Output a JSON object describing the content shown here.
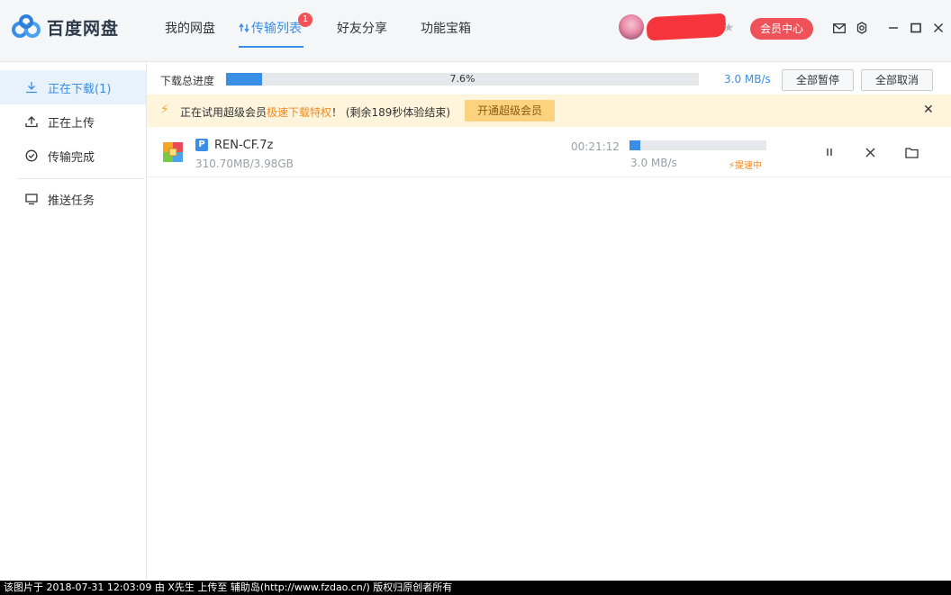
{
  "app": {
    "title": "百度网盘"
  },
  "nav": {
    "items": [
      {
        "label": "我的网盘"
      },
      {
        "label": "传输列表",
        "badge": "1"
      },
      {
        "label": "好友分享"
      },
      {
        "label": "功能宝箱"
      }
    ],
    "active_index": 1
  },
  "user": {
    "vip_button": "会员中心"
  },
  "icons": [
    "baidu-netdisk-logo-icon",
    "swap-arrows-icon",
    "star-icon",
    "mail-icon",
    "gear-icon",
    "minimize-icon",
    "maximize-icon",
    "close-icon",
    "download-icon",
    "upload-icon",
    "check-circle-icon",
    "monitor-icon",
    "lightning-icon",
    "archive-file-icon",
    "pause-icon",
    "cancel-icon",
    "folder-icon"
  ],
  "colors": {
    "accent": "#3a8ee6",
    "vip": "#f0525a",
    "promo_bg": "#fff5dd",
    "promo_highlight": "#f08a24"
  },
  "sidebar": {
    "items": [
      {
        "label": "正在下载(1)",
        "active": true
      },
      {
        "label": "正在上传"
      },
      {
        "label": "传输完成"
      },
      {
        "label": "推送任务"
      }
    ]
  },
  "transfer": {
    "total_label": "下载总进度",
    "total_progress": 0.076,
    "total_progress_text": "7.6%",
    "total_speed": "3.0 MB/s",
    "pause_all": "全部暂停",
    "cancel_all": "全部取消"
  },
  "promo": {
    "text_prefix": "正在试用超级会员",
    "text_highlight": "极速下载特权",
    "text_suffix": "！ (剩余189秒体验结束)",
    "button": "开通超级会员"
  },
  "files": [
    {
      "tag": "P",
      "name": "REN-CF.7z",
      "size": "310.70MB/3.98GB",
      "remaining": "00:21:12",
      "progress": 0.076,
      "speed": "3.0 MB/s",
      "accel_label": "提速中"
    }
  ],
  "footer": {
    "watermark": "该图片于 2018-07-31 12:03:09 由 X先生 上传至 辅助岛(http://www.fzdao.cn/) 版权归原创者所有"
  }
}
